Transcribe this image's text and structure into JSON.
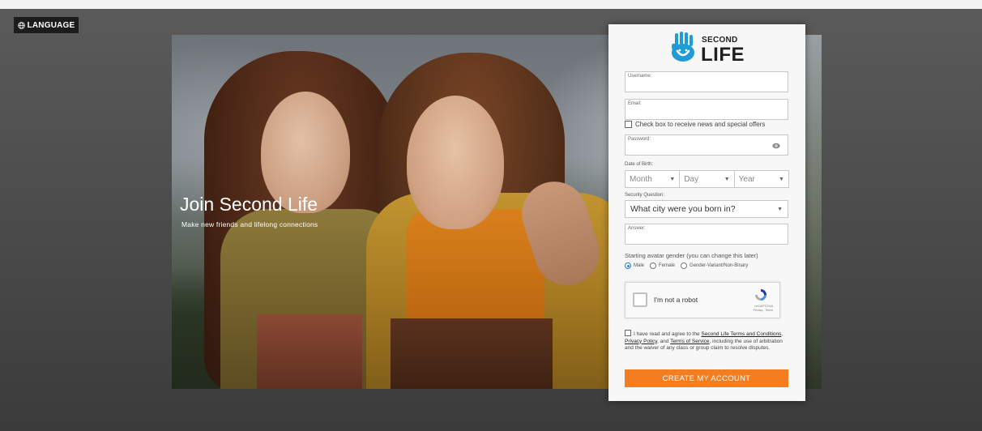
{
  "language_button": {
    "label": "LANGUAGE",
    "icon": "globe-icon"
  },
  "hero": {
    "title": "Join Second Life",
    "subtitle": "Make new friends and lifelong connections"
  },
  "logo": {
    "small": "SECOND",
    "big": "LIFE",
    "icon": "hand-icon",
    "color": "#1f9bd6"
  },
  "form": {
    "username_label": "Username:",
    "email_label": "Email:",
    "news_checkbox_label": "Check box to receive news and special offers",
    "password_label": "Password:",
    "dob_label": "Date of Birth:",
    "dob_month": "Month",
    "dob_day": "Day",
    "dob_year": "Year",
    "security_label": "Security Question:",
    "security_value": "What city were you born in?",
    "answer_label": "Answer:",
    "gender_title": "Starting avatar gender (you can change this later)",
    "gender_options": [
      "Male",
      "Female",
      "Gender-Variant/Non-Binary"
    ],
    "gender_selected": "Male",
    "captcha_text": "I'm not a robot",
    "captcha_brand": "reCAPTCHA",
    "captcha_links": "Privacy - Terms",
    "terms": {
      "part1": "I have read and agree to the ",
      "link1": "Second Life Terms and Conditions",
      "sep1": ", ",
      "link2": "Privacy Policy",
      "sep2": ", and ",
      "link3": "Terms of Service",
      "part2": ", including the use of arbitration and the waiver of any class or group claim to resolve disputes."
    },
    "submit_label": "CREATE MY ACCOUNT",
    "accent_color": "#f47d20"
  }
}
